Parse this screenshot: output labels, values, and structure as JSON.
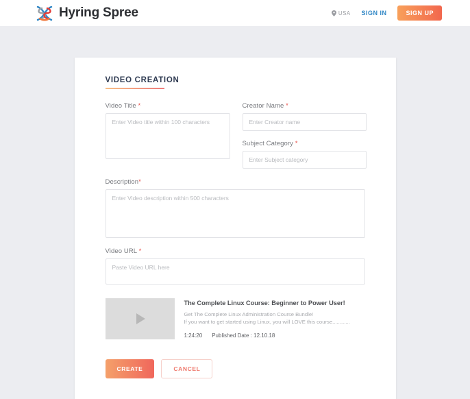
{
  "header": {
    "brand_name": "Hyring Spree",
    "logo_icon": "hyring-spree-logo-icon",
    "location_icon": "map-pin-icon",
    "location_label": "USA",
    "signin_label": "SIGN IN",
    "signup_label": "SIGN UP",
    "colors": {
      "signin": "#2f86c5",
      "signup_gradient_from": "#f8a05a",
      "signup_gradient_to": "#f2674e",
      "logo_blue": "#2f86c5",
      "logo_orange": "#f07a3f",
      "logo_red": "#e23b36"
    }
  },
  "form": {
    "title": "VIDEO CREATION",
    "required_marker": "*",
    "fields": {
      "video_title": {
        "label": "Video Title",
        "placeholder": "Enter Video title within 100 characters",
        "value": ""
      },
      "creator_name": {
        "label": "Creator Name",
        "placeholder": "Enter Creator name",
        "value": ""
      },
      "subject_category": {
        "label": "Subject Category",
        "placeholder": "Enter Subject category",
        "value": ""
      },
      "description": {
        "label": "Description",
        "placeholder": "Enter Video description within 500 characters",
        "value": ""
      },
      "video_url": {
        "label": "Video URL",
        "placeholder": "Paste Video URL here",
        "value": ""
      }
    }
  },
  "video_preview": {
    "play_icon": "play-triangle-icon",
    "title": "The Complete Linux Course: Beginner to Power User!",
    "description_line1": "Get The Complete Linux Administration Course Bundle!",
    "description_line2": "If you want to get started using Linux, you will LOVE this course............",
    "duration": "1:24:20",
    "published": "Published Date : 12.10.18"
  },
  "actions": {
    "create_label": "CREATE",
    "cancel_label": "CANCEL",
    "create_gradient_from": "#f4a06a",
    "create_gradient_to": "#f0675c",
    "cancel_text_color": "#ef7a6e"
  },
  "page": {
    "background": "#ecedf1",
    "card_background": "#ffffff"
  }
}
